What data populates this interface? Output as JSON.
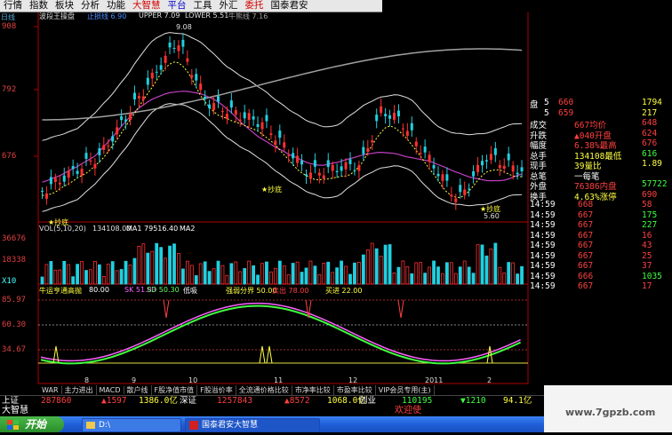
{
  "menu": {
    "items": [
      {
        "label": "行情",
        "style": "normal"
      },
      {
        "label": "指数",
        "style": "normal"
      },
      {
        "label": "板块",
        "style": "normal"
      },
      {
        "label": "分析",
        "style": "normal"
      },
      {
        "label": "功能",
        "style": "normal"
      },
      {
        "label": "大智慧",
        "style": "red"
      },
      {
        "label": "平台",
        "style": "blue"
      },
      {
        "label": "工具",
        "style": "normal"
      },
      {
        "label": "外汇",
        "style": "normal"
      },
      {
        "label": "委托",
        "style": "red"
      },
      {
        "label": "国泰君安",
        "style": "normal"
      }
    ]
  },
  "header": {
    "period": "日线",
    "title": "波段王操盘",
    "indicators": [
      {
        "label": "止损线 6.90",
        "color": "#4a8cff"
      },
      {
        "label": "UPPER 7.09",
        "color": "#e0e0e0"
      },
      {
        "label": "LOWER 5.51",
        "color": "#e0e0e0"
      },
      {
        "label": "牛熊线 7.16",
        "color": "#a0a0a0"
      }
    ]
  },
  "price_axis": {
    "labels": [
      "908",
      "792",
      "676"
    ]
  },
  "annotations": {
    "high_price": "9.08",
    "low_price": "5.60",
    "bottom_marks": [
      "★抄底",
      "★抄底",
      "★抄底"
    ]
  },
  "volume_panel": {
    "title": "VOL(5,10,20)",
    "vals": [
      {
        "label": "134108.00",
        "color": "#e0e0e0"
      },
      {
        "label": "MA1 79516.40",
        "color": "#ffffff"
      },
      {
        "label": "MA2",
        "color": "#ffffff"
      }
    ],
    "axis": [
      "36676",
      "18338",
      "X10"
    ]
  },
  "oscillator_panel": {
    "title": "牛运亨通高抛",
    "vals": [
      {
        "label": "80.00",
        "color": "#ffffff"
      },
      {
        "label": "SK 51.83",
        "color": "#ff60ff"
      },
      {
        "label": "SD 50.30",
        "color": "#60ff60"
      },
      {
        "label": "低吸",
        "color": "#ffffff"
      },
      {
        "label": "强弱分界 50.00",
        "color": "#ffff40"
      },
      {
        "label": "卖出 78.00",
        "color": "#ff4040"
      },
      {
        "label": "买进 22.00",
        "color": "#ffff40"
      }
    ],
    "axis": [
      "85.97",
      "60.30",
      "34.67"
    ],
    "date_labels": [
      "8",
      "9",
      "10",
      "11",
      "12",
      "2011",
      "2"
    ]
  },
  "quote_panel": {
    "rows": [
      [
        {
          "t": "盘",
          "c": "#ffffff"
        },
        {
          "t": "5",
          "c": "#ffffff"
        },
        {
          "t": "660",
          "c": "#ff4040"
        },
        {
          "t": "1794",
          "c": "#ffff40"
        }
      ],
      [
        {
          "t": "",
          "c": "#ffffff"
        },
        {
          "t": "5",
          "c": "#ffffff"
        },
        {
          "t": "659",
          "c": "#ff4040"
        },
        {
          "t": "217",
          "c": "#ffff40"
        }
      ],
      [
        {
          "t": "成交",
          "c": "#ffffff"
        },
        {
          "t": "",
          "c": "#fff"
        },
        {
          "t": "667均价",
          "c": "#ff4040"
        },
        {
          "t": "648",
          "c": "#ff4040"
        }
      ],
      [
        {
          "t": "升跌",
          "c": "#ffffff"
        },
        {
          "t": "",
          "c": "#fff"
        },
        {
          "t": "▲040开盘",
          "c": "#ff4040"
        },
        {
          "t": "624",
          "c": "#ff4040"
        }
      ],
      [
        {
          "t": "幅度",
          "c": "#ffffff"
        },
        {
          "t": "",
          "c": "#fff"
        },
        {
          "t": "6.38%最高",
          "c": "#ff4040"
        },
        {
          "t": "676",
          "c": "#ff4040"
        }
      ],
      [
        {
          "t": "总手",
          "c": "#ffffff"
        },
        {
          "t": "",
          "c": "#fff"
        },
        {
          "t": "134108最低",
          "c": "#ffff40"
        },
        {
          "t": "616",
          "c": "#40ff40"
        }
      ],
      [
        {
          "t": "现手",
          "c": "#ffffff"
        },
        {
          "t": "",
          "c": "#fff"
        },
        {
          "t": "39量比",
          "c": "#ffff40"
        },
        {
          "t": "1.89",
          "c": "#ffff40"
        }
      ],
      [
        {
          "t": "总笔",
          "c": "#ffffff"
        },
        {
          "t": "",
          "c": "#fff"
        },
        {
          "t": "一每笔",
          "c": "#ffffff"
        },
        {
          "t": "",
          "c": "#fff"
        }
      ],
      [
        {
          "t": "外盘",
          "c": "#ffffff"
        },
        {
          "t": "",
          "c": "#fff"
        },
        {
          "t": "76386内盘",
          "c": "#ff4040"
        },
        {
          "t": "57722",
          "c": "#40ff40"
        }
      ],
      [
        {
          "t": "换手",
          "c": "#ffffff"
        },
        {
          "t": "",
          "c": "#fff"
        },
        {
          "t": "4.63%涨停",
          "c": "#ffff40"
        },
        {
          "t": "690",
          "c": "#ff4040"
        }
      ],
      [
        {
          "t": "14:59",
          "c": "#ffffff"
        },
        {
          "t": "",
          "c": "#fff"
        },
        {
          "t": "668",
          "c": "#ff4040"
        },
        {
          "t": "58",
          "c": "#ff4040"
        }
      ],
      [
        {
          "t": "14:59",
          "c": "#ffffff"
        },
        {
          "t": "",
          "c": "#fff"
        },
        {
          "t": "667",
          "c": "#ff4040"
        },
        {
          "t": "175",
          "c": "#40ff40"
        }
      ],
      [
        {
          "t": "14:59",
          "c": "#ffffff"
        },
        {
          "t": "",
          "c": "#fff"
        },
        {
          "t": "667",
          "c": "#ff4040"
        },
        {
          "t": "227",
          "c": "#40ff40"
        }
      ],
      [
        {
          "t": "14:59",
          "c": "#ffffff"
        },
        {
          "t": "",
          "c": "#fff"
        },
        {
          "t": "667",
          "c": "#ff4040"
        },
        {
          "t": "16",
          "c": "#ff4040"
        }
      ],
      [
        {
          "t": "14:59",
          "c": "#ffffff"
        },
        {
          "t": "",
          "c": "#fff"
        },
        {
          "t": "667",
          "c": "#ff4040"
        },
        {
          "t": "43",
          "c": "#ff4040"
        }
      ],
      [
        {
          "t": "14:59",
          "c": "#ffffff"
        },
        {
          "t": "",
          "c": "#fff"
        },
        {
          "t": "667",
          "c": "#ff4040"
        },
        {
          "t": "25",
          "c": "#ff4040"
        }
      ],
      [
        {
          "t": "14:59",
          "c": "#ffffff"
        },
        {
          "t": "",
          "c": "#fff"
        },
        {
          "t": "667",
          "c": "#ff4040"
        },
        {
          "t": "37",
          "c": "#ff4040"
        }
      ],
      [
        {
          "t": "14:59",
          "c": "#ffffff"
        },
        {
          "t": "",
          "c": "#fff"
        },
        {
          "t": "666",
          "c": "#ff4040"
        },
        {
          "t": "1035",
          "c": "#40ff40"
        }
      ],
      [
        {
          "t": "14:59",
          "c": "#ffffff"
        },
        {
          "t": "",
          "c": "#fff"
        },
        {
          "t": "667",
          "c": "#ff4040"
        },
        {
          "t": "17",
          "c": "#ff4040"
        }
      ]
    ]
  },
  "indicator_tabs": [
    "WAR",
    "主力进出",
    "MACD",
    "散户线",
    "F股净值市值",
    "F股溢价率",
    "全流通价格比较",
    "市净率比较",
    "市盈率比较",
    "VIP会员专用(主)"
  ],
  "index_bar": {
    "cells": [
      {
        "t": "上证",
        "c": "#ffffff"
      },
      {
        "t": "287860",
        "c": "#ff4040"
      },
      {
        "t": "▲1597",
        "c": "#ff4040"
      },
      {
        "t": "1386.0亿",
        "c": "#ffff40"
      },
      {
        "t": "深证",
        "c": "#ffffff"
      },
      {
        "t": "1257843",
        "c": "#ff4040"
      },
      {
        "t": "▲8572",
        "c": "#ff4040"
      },
      {
        "t": "1068.0亿",
        "c": "#ffff40"
      },
      {
        "t": "创业",
        "c": "#ffffff"
      },
      {
        "t": "110195",
        "c": "#40ff40"
      },
      {
        "t": "▼1210",
        "c": "#40ff40"
      },
      {
        "t": "94.1亿",
        "c": "#ffff40"
      }
    ]
  },
  "status": {
    "brand": "大智慧",
    "welcome": "欢迎使"
  },
  "taskbar": {
    "start": "开始",
    "drive": "D:\\",
    "app": "国泰君安大智慧"
  },
  "watermark": "www.7gpzb.com",
  "colors": {
    "up": "#ff3030",
    "down": "#20d0e0",
    "bg": "#000000"
  }
}
